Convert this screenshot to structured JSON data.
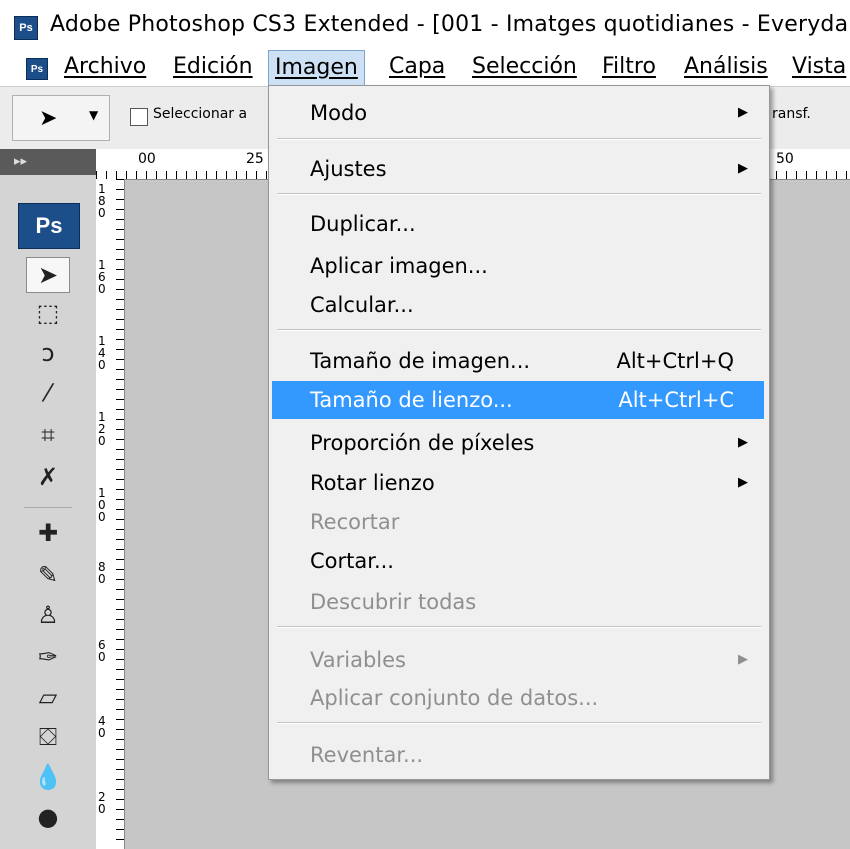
{
  "window": {
    "title": "Adobe Photoshop CS3 Extended - [001 - Imatges quotidianes - Everyda",
    "logo_text": "Ps"
  },
  "menubar": {
    "items": [
      {
        "label": "Archivo"
      },
      {
        "label": "Edición"
      },
      {
        "label": "Imagen",
        "active": true
      },
      {
        "label": "Capa"
      },
      {
        "label": "Selección"
      },
      {
        "label": "Filtro"
      },
      {
        "label": "Análisis"
      },
      {
        "label": "Vista"
      }
    ]
  },
  "options_bar": {
    "checkbox_label": "Seleccionar a",
    "right_text": "ransf."
  },
  "toolbox": {
    "header": "▸▸",
    "logo": "Ps"
  },
  "rulers": {
    "top": [
      "00",
      "25",
      "50"
    ],
    "left": [
      "180",
      "160",
      "140",
      "120",
      "100",
      "80",
      "60",
      "40",
      "20"
    ]
  },
  "dropdown": {
    "items": [
      {
        "label": "Modo",
        "submenu": true
      },
      {
        "label": "Ajustes",
        "submenu": true
      },
      {
        "label": "Duplicar..."
      },
      {
        "label": "Aplicar imagen..."
      },
      {
        "label": "Calcular..."
      },
      {
        "label": "Tamaño de imagen...",
        "shortcut": "Alt+Ctrl+Q"
      },
      {
        "label": "Tamaño de lienzo...",
        "shortcut": "Alt+Ctrl+C",
        "highlighted": true
      },
      {
        "label": "Proporción de píxeles",
        "submenu": true
      },
      {
        "label": "Rotar lienzo",
        "submenu": true
      },
      {
        "label": "Recortar",
        "disabled": true
      },
      {
        "label": "Cortar..."
      },
      {
        "label": "Descubrir todas",
        "disabled": true
      },
      {
        "label": "Variables",
        "submenu": true,
        "disabled": true
      },
      {
        "label": "Aplicar conjunto de datos...",
        "disabled": true
      },
      {
        "label": "Reventar...",
        "disabled": true
      }
    ]
  },
  "colors": {
    "highlight": "#3399ff",
    "menu_bg": "#f0f0f0",
    "canvas_bg": "#c6c6c6",
    "ps_blue": "#1c4f8a"
  }
}
